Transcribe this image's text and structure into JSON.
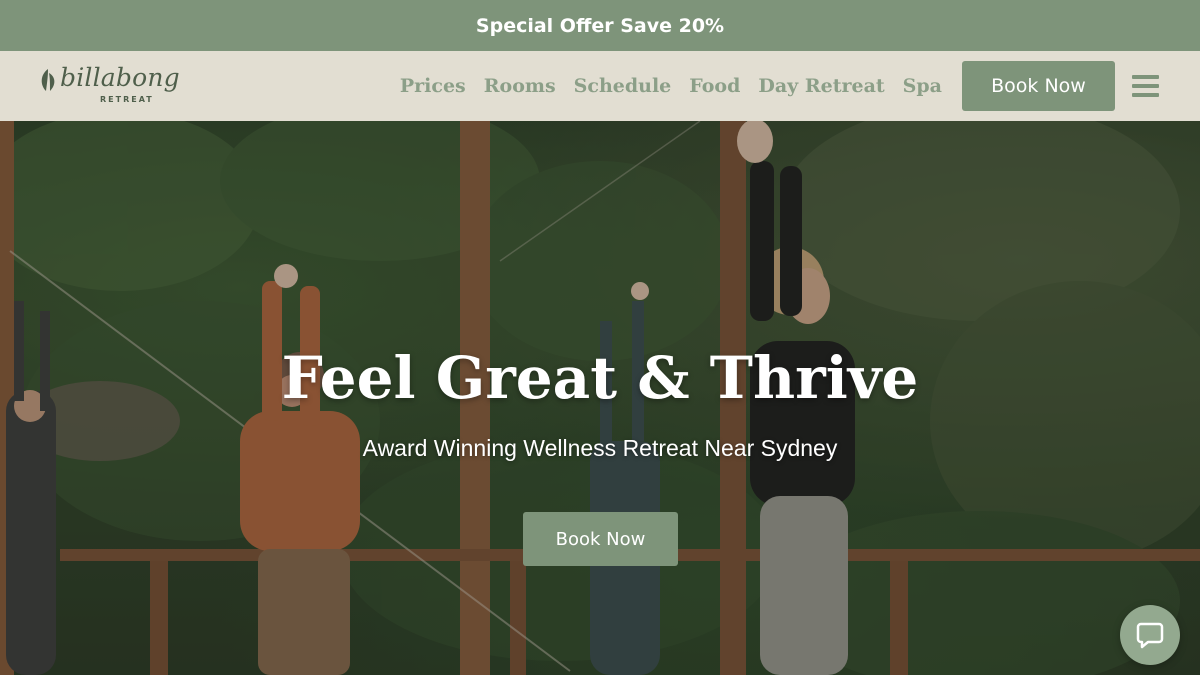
{
  "promo": {
    "text": "Special Offer Save 20%"
  },
  "logo": {
    "wordmark": "billabong",
    "subtext": "RETREAT",
    "icon": "leaf-icon"
  },
  "nav": {
    "items": [
      {
        "label": "Prices"
      },
      {
        "label": "Rooms"
      },
      {
        "label": "Schedule"
      },
      {
        "label": "Food"
      },
      {
        "label": "Day Retreat"
      },
      {
        "label": "Spa"
      }
    ],
    "book_label": "Book Now",
    "menu_icon": "hamburger-menu-icon"
  },
  "hero": {
    "title": "Feel Great & Thrive",
    "subtitle": "Award Winning Wellness Retreat Near Sydney",
    "book_label": "Book Now"
  },
  "chat": {
    "icon": "chat-bubble-icon"
  },
  "colors": {
    "brand_green": "#7e947a",
    "nav_background": "#e2ded2",
    "nav_text": "#8c9f88",
    "logo_text": "#4f5f4b"
  }
}
